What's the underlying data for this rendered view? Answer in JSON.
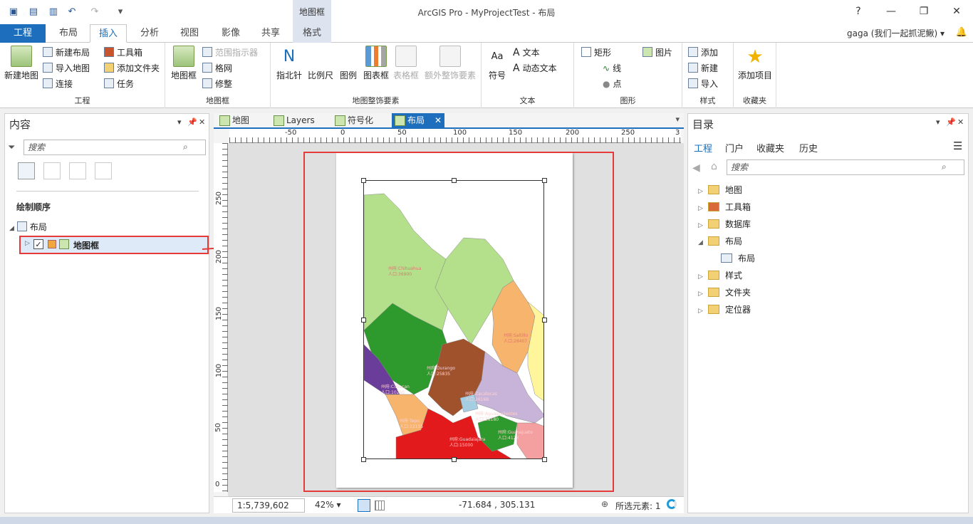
{
  "title_bar": {
    "title": "ArcGIS Pro - MyProjectTest - 布局",
    "context_group": "地图框",
    "help": "?",
    "minimize": "—",
    "restore": "❐",
    "close": "✕"
  },
  "ribbon_tabs": [
    "工程",
    "布局",
    "插入",
    "分析",
    "视图",
    "影像",
    "共享",
    "格式"
  ],
  "user": "gaga (我们一起抓泥鳅) ▾",
  "ribbon": {
    "project": {
      "label": "工程",
      "new_map": "新建地图",
      "new_layout": "新建布局",
      "import_map": "导入地图",
      "connect": "连接",
      "toolbox": "工具箱",
      "add_folder": "添加文件夹",
      "task": "任务"
    },
    "map_frames": {
      "label": "地图框",
      "map_frame": "地图框",
      "extent_indicator": "范围指示器",
      "grid": "格网",
      "trim": "修整"
    },
    "surround": {
      "label": "地图整饰要素",
      "north_arrow": "指北针",
      "scale_bar": "比例尺",
      "legend": "图例",
      "chart_frame": "图表框",
      "table_frame": "表格框",
      "extra": "额外整饰要素"
    },
    "text": {
      "label": "文本",
      "symbol": "符号",
      "text": "文本",
      "dynamic_text": "动态文本"
    },
    "graphics": {
      "label": "图形",
      "rectangle": "矩形",
      "picture": "图片",
      "line": "线",
      "point": "点"
    },
    "styles": {
      "label": "样式",
      "add": "添加",
      "new": "新建",
      "import": "导入"
    },
    "favorites": {
      "label": "收藏夹",
      "add_item": "添加项目"
    }
  },
  "contents": {
    "title": "内容",
    "search_placeholder": "搜索",
    "draw_order": "绘制顺序",
    "layout_node": "布局",
    "map_frame_node": "地图框"
  },
  "doc_tabs": [
    "地图",
    "Layers",
    "符号化",
    "布局"
  ],
  "ruler_top": [
    "-50",
    "0",
    "50",
    "100",
    "150",
    "200",
    "250",
    "3"
  ],
  "ruler_left": [
    "250",
    "200",
    "150",
    "100",
    "50",
    "0"
  ],
  "map_labels": [
    {
      "name": "州府:Chihuahua",
      "pop": "人口:36900"
    },
    {
      "name": "州府:Saltillo",
      "pop": "人口:28407"
    },
    {
      "name": "州府:Durango",
      "pop": "人口:25835"
    },
    {
      "name": "州府:Culiacan",
      "pop": "人口:10265"
    },
    {
      "name": "州府:Tepic",
      "pop": "人口:12155"
    },
    {
      "name": "州府:Zacatecas",
      "pop": "人口:26168"
    },
    {
      "name": "州府:Guadalajara",
      "pop": "人口:15000"
    },
    {
      "name": "州府:Aguascalientes",
      "pop": "人口:28180"
    },
    {
      "name": "州府:Guanajuato",
      "pop": "人口:4123"
    }
  ],
  "status": {
    "scale": "1:5,739,602",
    "zoom": "42%",
    "coords": "-71.684 , 305.131",
    "selected": "所选元素: 1"
  },
  "catalog": {
    "title": "目录",
    "tabs": [
      "工程",
      "门户",
      "收藏夹",
      "历史"
    ],
    "search_placeholder": "搜索",
    "items": [
      "地图",
      "工具箱",
      "数据库",
      "布局",
      "布局",
      "样式",
      "文件夹",
      "定位器"
    ]
  },
  "colors": {
    "accent": "#1d6fbd",
    "highlight": "#e53a3a"
  }
}
